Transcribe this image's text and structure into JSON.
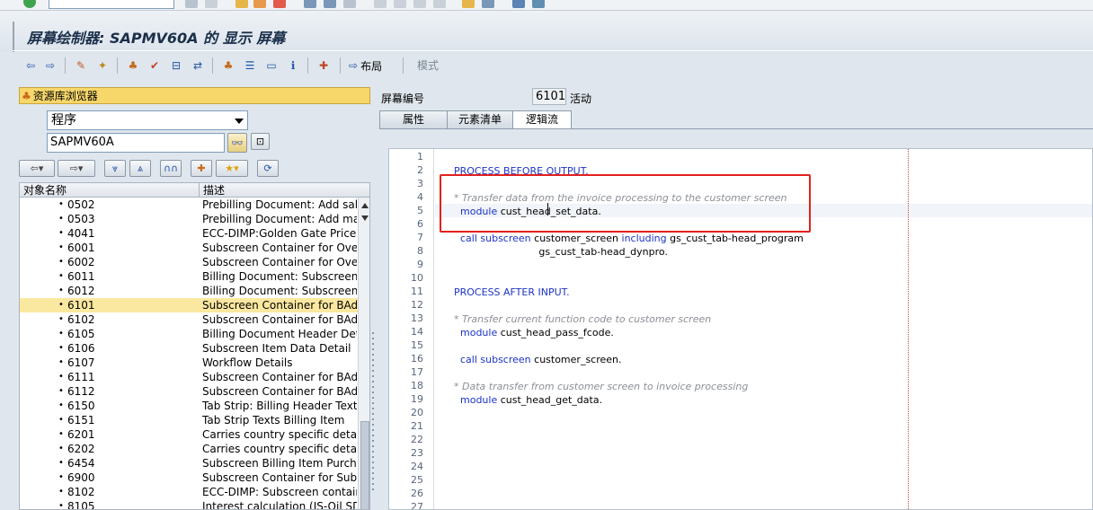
{
  "window": {
    "title": "屏幕绘制器: SAPMV60A 的 显示 屏幕"
  },
  "toolbar": {
    "layout_label": "布局",
    "mode_label": "模式"
  },
  "repo_browser": {
    "header": "资源库浏览器",
    "object_type": "程序",
    "object_name": "SAPMV60A",
    "columns": [
      "对象名称",
      "描述"
    ],
    "rows": [
      {
        "name": "0502",
        "desc": "Prebilling Document: Add sales"
      },
      {
        "name": "0503",
        "desc": "Prebilling Document: Add manu"
      },
      {
        "name": "4041",
        "desc": "ECC-DIMP:Golden Gate Price Pr"
      },
      {
        "name": "6001",
        "desc": "Subscreen Container for Overvi"
      },
      {
        "name": "6002",
        "desc": "Subscreen Container for Overvi"
      },
      {
        "name": "6011",
        "desc": "Billing Document: Subscreen, G"
      },
      {
        "name": "6012",
        "desc": "Billing Document: Subscreen, G"
      },
      {
        "name": "6101",
        "desc": "Subscreen Container for BAdI L",
        "selected": true
      },
      {
        "name": "6102",
        "desc": "Subscreen Container for BAdI L"
      },
      {
        "name": "6105",
        "desc": "Billing Document Header Detail"
      },
      {
        "name": "6106",
        "desc": "Subscreen Item Data Detail"
      },
      {
        "name": "6107",
        "desc": "Workflow Details"
      },
      {
        "name": "6111",
        "desc": "Subscreen Container for BAdI L"
      },
      {
        "name": "6112",
        "desc": "Subscreen Container for BAdI L"
      },
      {
        "name": "6150",
        "desc": "Tab Strip: Billing Header Texts"
      },
      {
        "name": "6151",
        "desc": "Tab Strip Texts Billing Item"
      },
      {
        "name": "6201",
        "desc": "Carries country specific detail sc"
      },
      {
        "name": "6202",
        "desc": "Carries country specific detail sc"
      },
      {
        "name": "6454",
        "desc": "Subscreen Billing Item Purchasir"
      },
      {
        "name": "6900",
        "desc": "Subscreen Container for Subscr"
      },
      {
        "name": "8102",
        "desc": "ECC-DIMP: Subscreen container"
      },
      {
        "name": "8105",
        "desc": "Interest calculation (IS-Oil SDP"
      }
    ]
  },
  "screen_info": {
    "label": "屏幕编号",
    "number": "6101",
    "status": "活动"
  },
  "tabs": [
    "属性",
    "元素清单",
    "逻辑流"
  ],
  "active_tab": "逻辑流",
  "flow_logic": {
    "line_count": 27,
    "lines": [
      {
        "n": 2,
        "segments": [
          {
            "t": "PROCESS BEFORE OUTPUT.",
            "k": "kw"
          }
        ]
      },
      {
        "n": 4,
        "segments": [
          {
            "t": "* Transfer data from the invoice processing to the customer screen",
            "k": "cm"
          }
        ]
      },
      {
        "n": 5,
        "segments": [
          {
            "t": "  module ",
            "k": "kw"
          },
          {
            "t": "cust_head_set_data.",
            "k": ""
          }
        ]
      },
      {
        "n": 7,
        "segments": [
          {
            "t": "  call subscreen ",
            "k": "kw"
          },
          {
            "t": "customer_screen ",
            "k": ""
          },
          {
            "t": "including ",
            "k": "kw"
          },
          {
            "t": "gs_cust_tab-head_program",
            "k": ""
          }
        ]
      },
      {
        "n": 8,
        "segments": [
          {
            "t": "                           gs_cust_tab-head_dynpro.",
            "k": ""
          }
        ]
      },
      {
        "n": 11,
        "segments": [
          {
            "t": "PROCESS AFTER INPUT.",
            "k": "kw"
          }
        ]
      },
      {
        "n": 13,
        "segments": [
          {
            "t": "* Transfer current function code to customer screen",
            "k": "cm"
          }
        ]
      },
      {
        "n": 14,
        "segments": [
          {
            "t": "  module ",
            "k": "kw"
          },
          {
            "t": "cust_head_pass_fcode.",
            "k": ""
          }
        ]
      },
      {
        "n": 16,
        "segments": [
          {
            "t": "  call subscreen ",
            "k": "kw"
          },
          {
            "t": "customer_screen.",
            "k": ""
          }
        ]
      },
      {
        "n": 18,
        "segments": [
          {
            "t": "* Data transfer from customer screen to invoice processing",
            "k": "cm"
          }
        ]
      },
      {
        "n": 19,
        "segments": [
          {
            "t": "  module ",
            "k": "kw"
          },
          {
            "t": "cust_head_get_data.",
            "k": ""
          }
        ]
      }
    ]
  }
}
